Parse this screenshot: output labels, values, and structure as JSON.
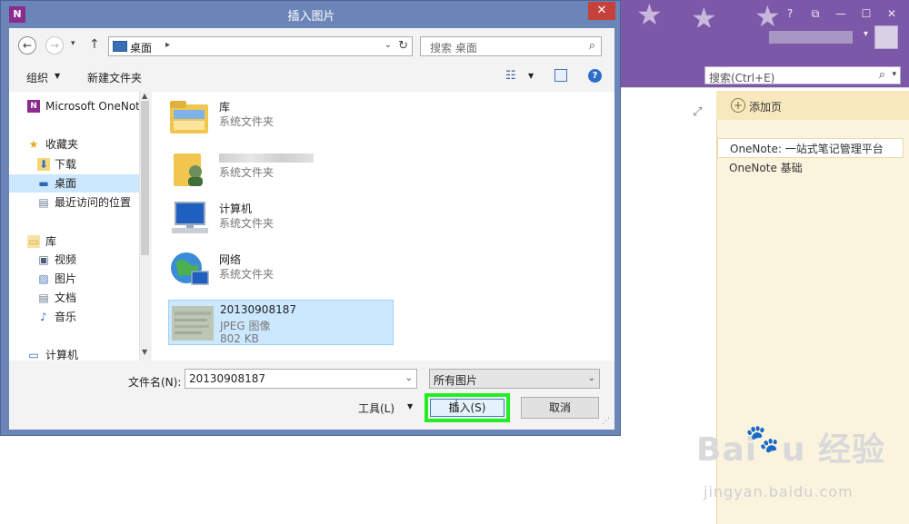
{
  "onenote": {
    "search_placeholder": "搜索(Ctrl+E)",
    "add_page_label": "添加页",
    "pages": [
      "OneNote: 一站式笔记管理平台",
      "OneNote 基础"
    ],
    "window_controls": [
      "?",
      "⧉",
      "—",
      "☐",
      "✕"
    ]
  },
  "dialog": {
    "title": "插入图片",
    "app_icon_text": "N",
    "close_glyph": "✕",
    "address": {
      "location": "桌面"
    },
    "search_placeholder": "搜索 桌面",
    "toolbar": {
      "organize_label": "组织",
      "new_folder_label": "新建文件夹"
    },
    "nav_tree": [
      {
        "label": "Microsoft OneNote",
        "icon": "onenote-icon",
        "glyph": "N"
      },
      {
        "label": "收藏夹",
        "icon": "star-icon",
        "glyph": "★"
      },
      {
        "label": "下载",
        "icon": "download-folder-icon",
        "glyph": "⬇"
      },
      {
        "label": "桌面",
        "icon": "desktop-icon",
        "glyph": "▬",
        "selected": true
      },
      {
        "label": "最近访问的位置",
        "icon": "recent-places-icon",
        "glyph": "▤"
      },
      {
        "label": "库",
        "icon": "library-icon",
        "glyph": "▭"
      },
      {
        "label": "视频",
        "icon": "video-icon",
        "glyph": "▣"
      },
      {
        "label": "图片",
        "icon": "pictures-icon",
        "glyph": "▨"
      },
      {
        "label": "文档",
        "icon": "documents-icon",
        "glyph": "▤"
      },
      {
        "label": "音乐",
        "icon": "music-icon",
        "glyph": "♪"
      },
      {
        "label": "计算机",
        "icon": "computer-icon",
        "glyph": "▭"
      }
    ],
    "files": [
      {
        "name": "库",
        "type": "系统文件夹"
      },
      {
        "name": "",
        "type": "系统文件夹"
      },
      {
        "name": "计算机",
        "type": "系统文件夹"
      },
      {
        "name": "网络",
        "type": "系统文件夹"
      },
      {
        "name": "20130908187",
        "type": "JPEG 图像",
        "size": "802 KB"
      }
    ],
    "file_name_label": "文件名(N):",
    "file_name_value": "20130908187",
    "file_type_value": "所有图片",
    "tools_label": "工具(L)",
    "insert_label": "插入(S)",
    "cancel_label": "取消"
  },
  "watermark": {
    "brand": "Baidu 经验",
    "url": "jingyan.baidu.com"
  },
  "colors": {
    "onenote_purple": "#7b58a8",
    "dialog_frame": "#6b85b8",
    "selection": "#cce8ff",
    "highlight_box": "#22ee22",
    "close_red": "#c6413a"
  }
}
